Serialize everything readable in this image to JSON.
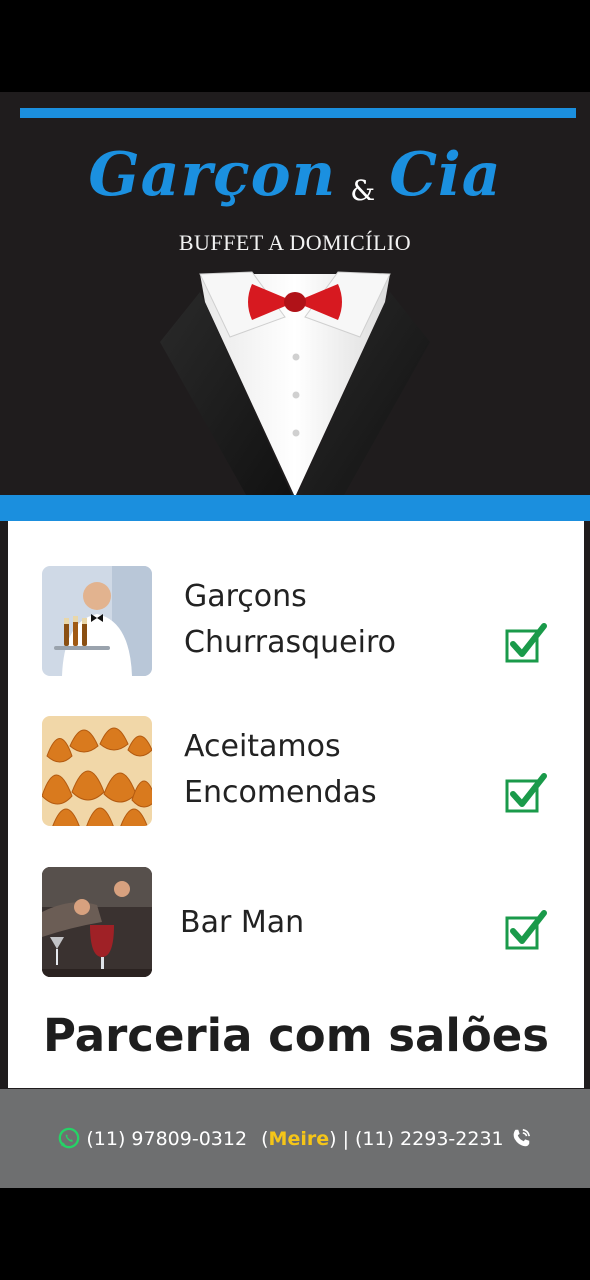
{
  "brand": {
    "name_left": "Garçon",
    "ampersand": "&",
    "name_right": "Cia",
    "tagline": "BUFFET A DOMICÍLIO"
  },
  "colors": {
    "accent_blue": "#1b8fde",
    "dark_bg": "#1f1c1d",
    "bowtie_red": "#d71920",
    "check_green": "#1a9a4a",
    "highlight_yellow": "#f5c518",
    "footer_gray": "#6e6f70"
  },
  "services": [
    {
      "line1": "Garçons",
      "line2": "Churrasqueiro",
      "icon": "waiter-photo",
      "check": "checkbox-checked-icon"
    },
    {
      "line1": "Aceitamos",
      "line2": "Encomendas",
      "icon": "coxinha-photo",
      "check": "checkbox-checked-icon"
    },
    {
      "line1": "Bar Man",
      "line2": "",
      "icon": "bartender-photo",
      "check": "checkbox-checked-icon"
    }
  ],
  "partnership": "Parceria com salões",
  "contact": {
    "whatsapp_icon": "whatsapp-icon",
    "phone1": "(11)  97809-0312",
    "open_paren": "(",
    "contact_name": "Meire",
    "close_paren": ")",
    "separator": "|",
    "phone2": "(11) 2293-2231",
    "phone_icon": "phone-icon"
  }
}
